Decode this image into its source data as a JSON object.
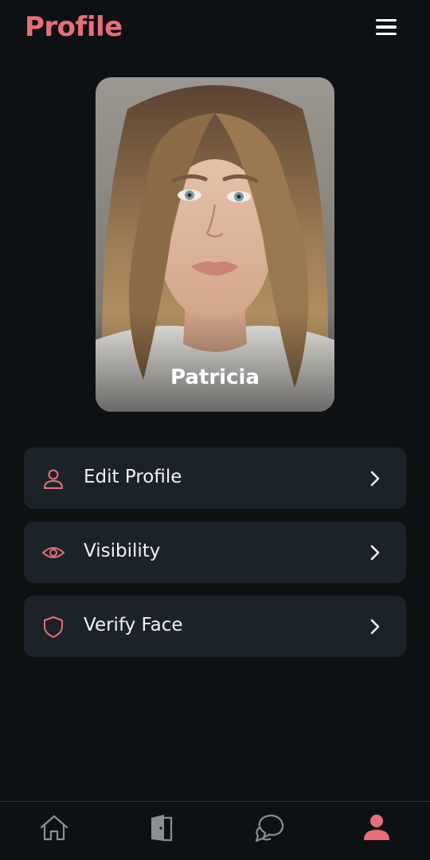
{
  "header": {
    "title": "Profile",
    "menu_icon": "hamburger-menu-icon"
  },
  "profile": {
    "name": "Patricia"
  },
  "menu": {
    "items": [
      {
        "label": "Edit Profile",
        "icon": "user-icon"
      },
      {
        "label": "Visibility",
        "icon": "eye-icon"
      },
      {
        "label": "Verify Face",
        "icon": "shield-icon"
      }
    ]
  },
  "bottom_nav": {
    "items": [
      {
        "icon": "home-icon",
        "active": false
      },
      {
        "icon": "door-icon",
        "active": false
      },
      {
        "icon": "chat-bubbles-icon",
        "active": false
      },
      {
        "icon": "profile-icon",
        "active": true
      }
    ]
  },
  "colors": {
    "accent": "#e86f78",
    "background": "#0e1114",
    "card": "#1c2229",
    "nav_inactive": "#8a8f96",
    "text": "#f1f3f5"
  }
}
